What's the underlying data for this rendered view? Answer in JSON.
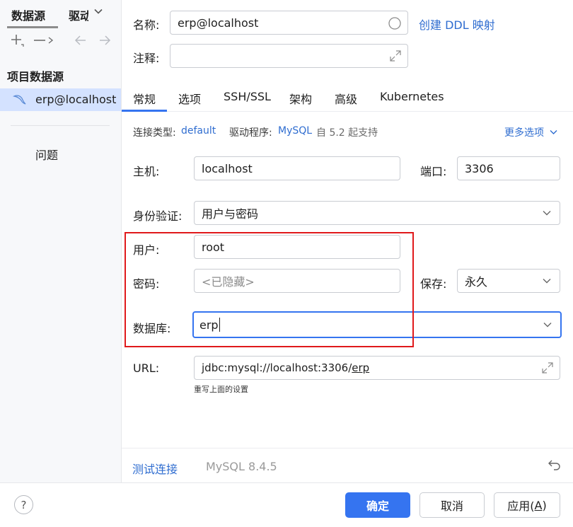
{
  "sidebar": {
    "tabs": [
      {
        "label": "数据源"
      },
      {
        "label": "驱动"
      }
    ],
    "group_title": "项目数据源",
    "datasource_item": "erp@localhost",
    "problems_label": "问题"
  },
  "general": {
    "name_label": "名称:",
    "name_value": "erp@localhost",
    "create_ddl_link": "创建 DDL 映射",
    "comment_label": "注释:",
    "comment_value": ""
  },
  "tabs": [
    "常规",
    "选项",
    "SSH/SSL",
    "架构",
    "高级",
    "Kubernetes"
  ],
  "connection_info": {
    "type_label": "连接类型:",
    "type_value": "default",
    "driver_label": "驱动程序:",
    "driver_value": "MySQL",
    "driver_suffix": "自 5.2 起支持",
    "more_options": "更多选项"
  },
  "form": {
    "host_label": "主机:",
    "host_value": "localhost",
    "port_label": "端口:",
    "port_value": "3306",
    "auth_label": "身份验证:",
    "auth_value": "用户与密码",
    "user_label": "用户:",
    "user_value": "root",
    "password_label": "密码:",
    "password_placeholder": "<已隐藏>",
    "save_label": "保存:",
    "save_value": "永久",
    "database_label": "数据库:",
    "database_value": "erp",
    "url_label": "URL:",
    "url_prefix": "jdbc:mysql://localhost:3306/",
    "url_db": "erp",
    "url_hint": "重写上面的设置"
  },
  "status": {
    "test_connection": "测试连接",
    "version": "MySQL 8.4.5"
  },
  "footer": {
    "help": "?",
    "ok": "确定",
    "cancel": "取消",
    "apply_prefix": "应用(",
    "apply_mnemonic": "A",
    "apply_suffix": ")"
  },
  "colors": {
    "accent": "#3574f0",
    "link": "#2f6dd0",
    "highlight_box": "#e0191b",
    "selected_row": "#d4e2ff"
  },
  "icons": [
    "add-icon",
    "remove-icon",
    "back-arrow-icon",
    "forward-arrow-icon",
    "mysql-dolphin-icon",
    "chevron-down-icon",
    "expand-icon",
    "revert-icon",
    "help-icon"
  ]
}
